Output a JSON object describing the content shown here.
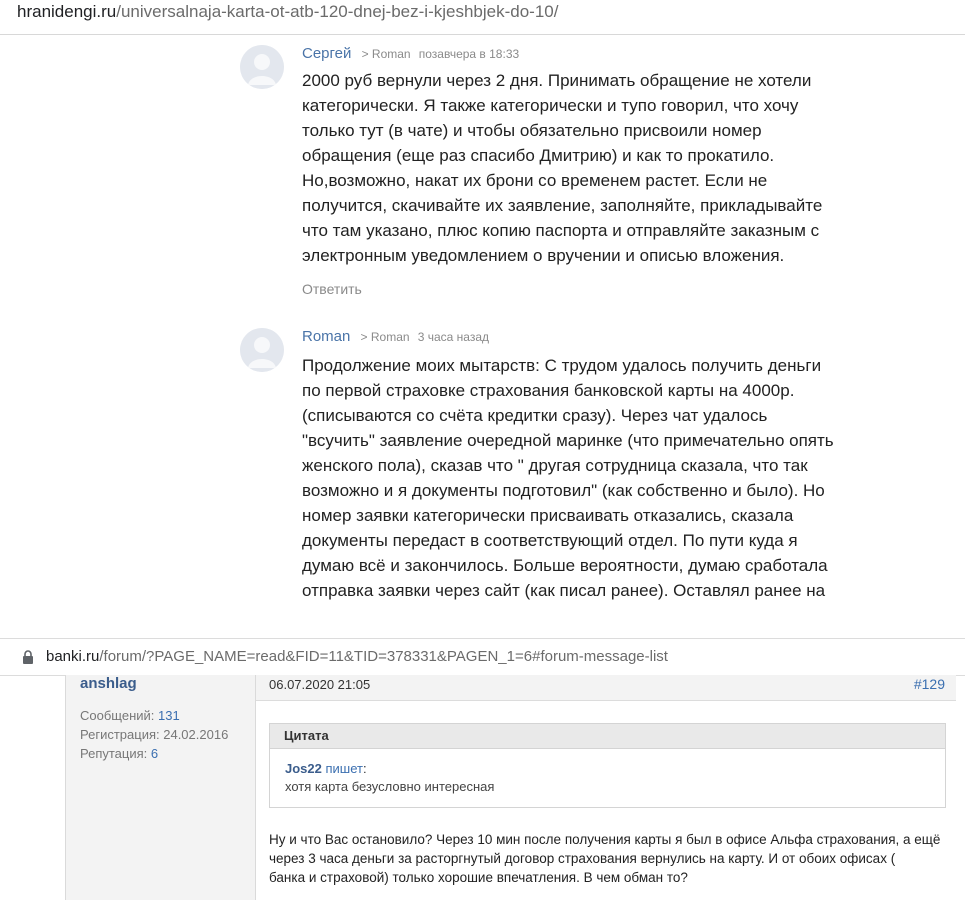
{
  "browser_top": {
    "host": "hranidengi.ru",
    "path": "/universalnaja-karta-ot-atb-120-dnej-bez-i-kjeshbjek-do-10/"
  },
  "comments": [
    {
      "author": "Сергей",
      "reply_to": "> Roman",
      "time": "позавчера в 18:33",
      "lines": [
        "2000 руб вернули через 2 дня. Принимать обращение не хотели",
        "категорически. Я также категорически и тупо говорил, что хочу",
        "только тут (в чате) и чтобы обязательно присвоили номер",
        "обращения (еще раз спасибо Дмитрию) и как то прокатило.",
        "Но,возможно, накат их брони со временем растет. Если не",
        "получится, скачивайте их заявление, заполняйте, прикладывайте",
        "что там указано, плюс копию паспорта и отправляйте заказным с",
        "электронным уведомлением о вручении и описью вложения."
      ],
      "reply_label": "Ответить"
    },
    {
      "author": "Roman",
      "reply_to": "> Roman",
      "time": "3 часа назад",
      "lines": [
        "Продолжение моих мытарств: С трудом удалось получить деньги",
        "по первой страховке страхования банковской карты на 4000р.",
        "(списываются со счёта кредитки сразу). Через чат удалось",
        "\"всучить\" заявление очередной маринке (что примечательно опять",
        "женского пола), сказав что \" другая сотрудница сказала, что так",
        "возможно и я документы подготовил\" (как собственно и было). Но",
        "номер заявки категорически присваивать отказались, сказала",
        "документы передаст в соответствующий отдел. По пути куда я",
        "думаю всё и закончилось. Больше вероятности, думаю сработала",
        "отправка заявки через сайт (как писал ранее). Оставлял ранее на"
      ]
    }
  ],
  "browser_bottom": {
    "host": "banki.ru",
    "path": "/forum/?PAGE_NAME=read&FID=11&TID=378331&PAGEN_1=6#forum-message-list"
  },
  "forum_post": {
    "nick": "anshlag",
    "messages_label": "Сообщений:",
    "messages_count": "131",
    "registration_label": "Регистрация:",
    "registration_date": "24.02.2016",
    "reputation_label": "Репутация:",
    "reputation_value": "6",
    "date": "06.07.2020 21:05",
    "post_number": "#129",
    "quote_title": "Цитата",
    "quote_author": "Jos22",
    "quote_writes": "пишет",
    "quote_colon": ":",
    "quote_text": "хотя карта безусловно интересная",
    "text_lines": [
      "Ну и что Вас остановило? Через 10 мин после получения карты я был в офисе Альфа страхования, а ещё",
      "через 3 часа деньги за расторгнутый договор страхования вернулись на карту. И от обоих офисах (",
      "банка и страховой) только хорошие впечатления. В чем обман то?"
    ]
  }
}
